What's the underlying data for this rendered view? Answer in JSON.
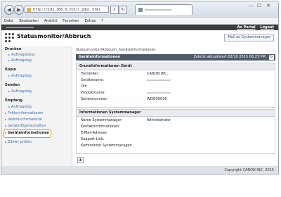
{
  "browser": {
    "address": "http://192.168.0.215/j_pdsi.html",
    "menu": [
      "Datei",
      "Bearbeiten",
      "Ansicht",
      "Favoriten",
      "Extras",
      "?"
    ]
  },
  "header": {
    "links": [
      "An Portal",
      "Logout"
    ],
    "title": "Statusmonitor/Abbruch",
    "mail_button": "Mail an Systemmanager"
  },
  "sidebar": {
    "groups": [
      {
        "label": "Drucken",
        "items": [
          "Auftragstatus",
          "Auftragslog"
        ]
      },
      {
        "label": "Kopie",
        "items": [
          "Auftragslog"
        ]
      },
      {
        "label": "Senden",
        "items": [
          "Auftragslog"
        ]
      },
      {
        "label": "Empfang",
        "items": [
          "Auftragslog"
        ]
      }
    ],
    "links": [
      "Fehlerinformationen",
      "Verbrauchsmaterial",
      "Geräte-Eigenschaften",
      "Geräteinformationen",
      "Zähler prüfen"
    ],
    "selected": "Geräteinformationen"
  },
  "main": {
    "breadcrumb": "Statusmonitor/Abbruch: Geräteinformationen",
    "bar_title": "Geräteinformationen",
    "updated": "Zuletzt aktualisiert:02/10 2015 06:23 PM",
    "sections": [
      {
        "title": "Grundinformationen Gerät",
        "rows": [
          {
            "label": "Hersteller:",
            "value": "CANON INC."
          },
          {
            "label": "Gerätename:",
            "value": ""
          },
          {
            "label": "Ort:",
            "value": ""
          },
          {
            "label": "Produktname:",
            "value": ""
          },
          {
            "label": "Seriennummer:",
            "value": "WDG00035"
          }
        ]
      },
      {
        "title": "Informationen Systemmanager",
        "rows": [
          {
            "label": "Name Systemmanager:",
            "value": "Administrator"
          },
          {
            "label": "Kontaktinformationen:",
            "value": ""
          },
          {
            "label": "E-Mail-Adresse:",
            "value": ""
          },
          {
            "label": "Support-Link:",
            "value": ""
          },
          {
            "label": "Kommentar Systemmanager:",
            "value": ""
          }
        ]
      }
    ]
  },
  "footer": {
    "copyright": "Copyright CANON INC. 2015"
  }
}
